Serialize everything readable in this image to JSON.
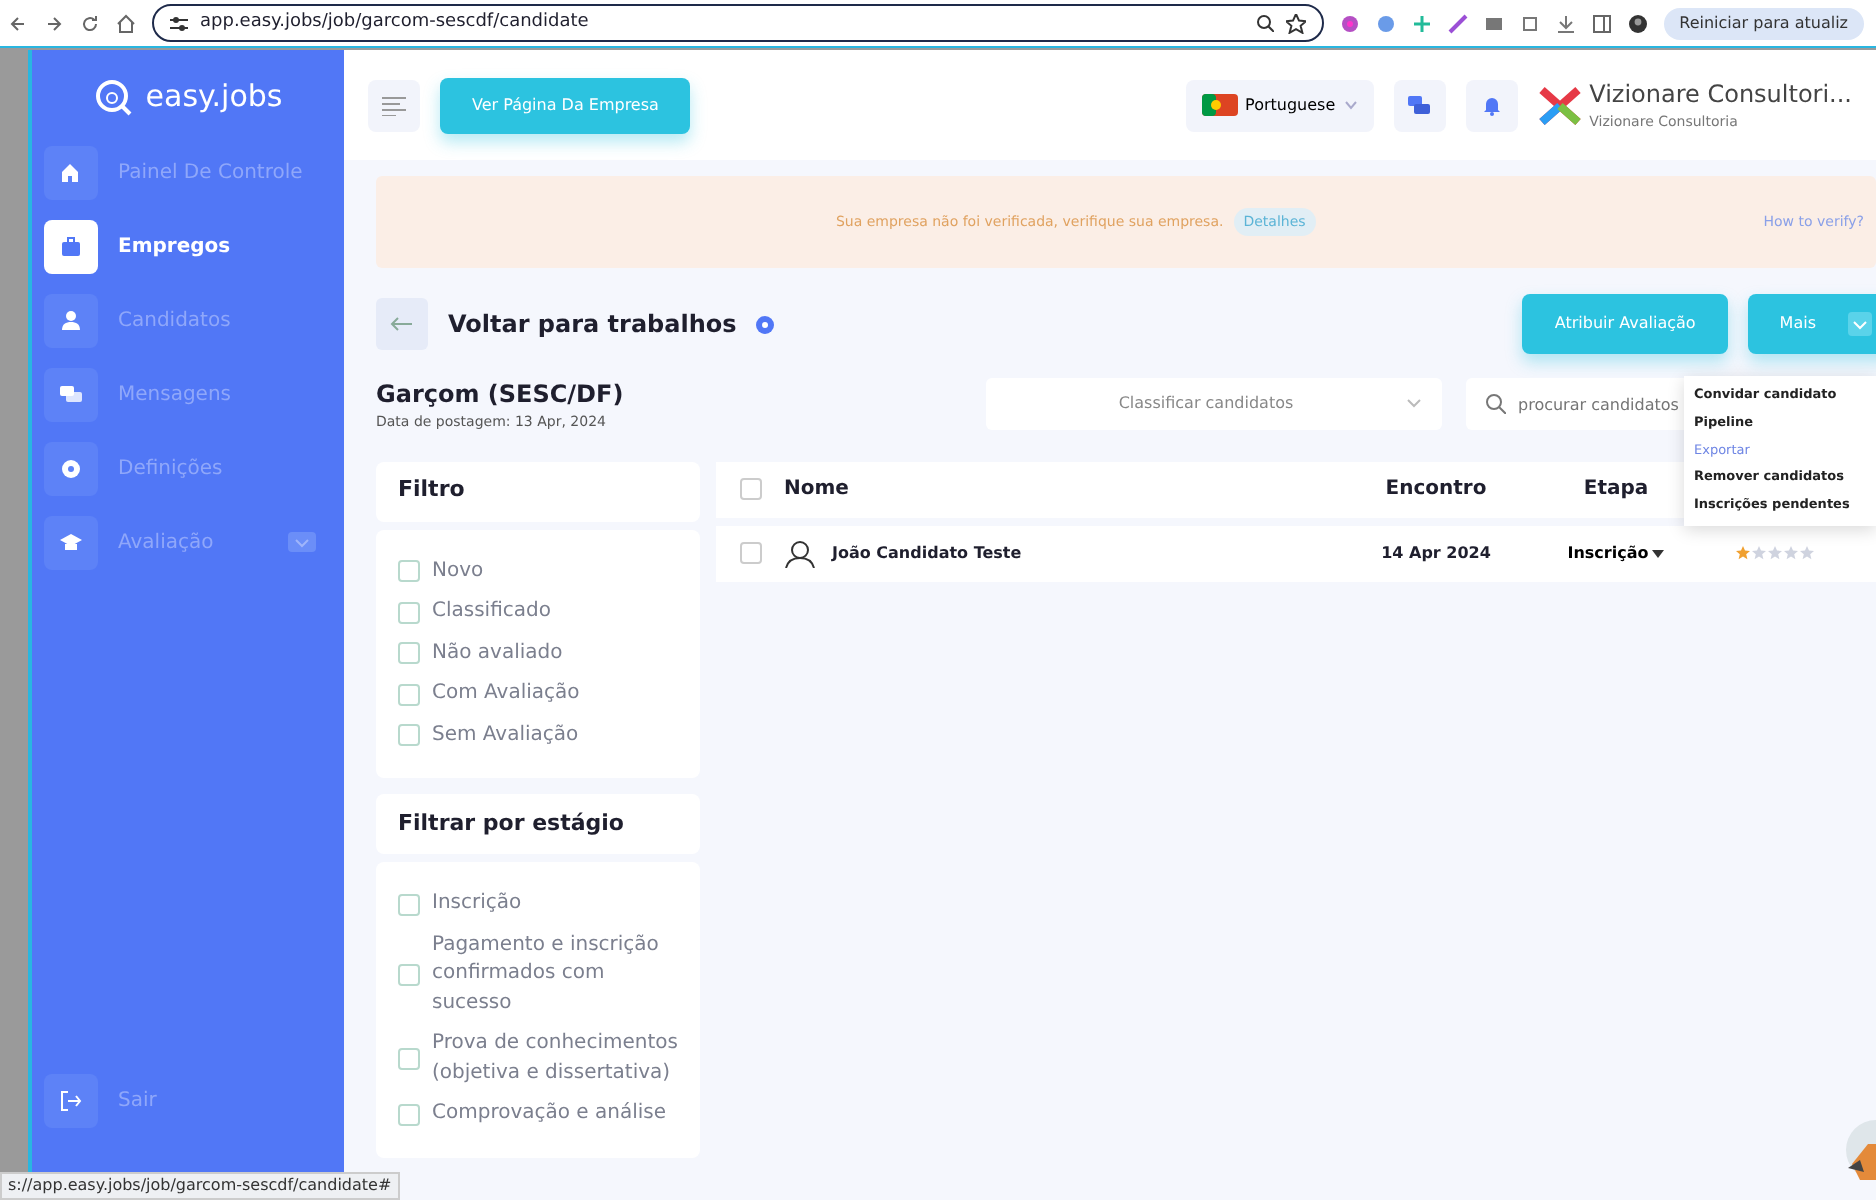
{
  "browser": {
    "url": "app.easy.jobs/job/garcom-sescdf/candidate",
    "restart_button": "Reiniciar para atualiz"
  },
  "sidebar": {
    "logo": "easy.jobs",
    "items": [
      {
        "label": "Painel De Controle",
        "selected": false,
        "expandable": false
      },
      {
        "label": "Empregos",
        "selected": true,
        "expandable": false
      },
      {
        "label": "Candidatos",
        "selected": false,
        "expandable": false
      },
      {
        "label": "Mensagens",
        "selected": false,
        "expandable": false
      },
      {
        "label": "Definições",
        "selected": false,
        "expandable": false
      },
      {
        "label": "Avaliação",
        "selected": false,
        "expandable": true
      }
    ],
    "logout": "Sair"
  },
  "topbar": {
    "company_page_button": "Ver Página Da Empresa",
    "language": "Portuguese",
    "company_name": "Vizionare Consultori...",
    "company_subtitle": "Vizionare Consultoria"
  },
  "alert": {
    "message": "Sua empresa não foi verificada, verifique sua empresa.",
    "details_button": "Detalhes",
    "help_link": "How to verify?"
  },
  "back_link": "Voltar para trabalhos",
  "actions": {
    "assign_button": "Atribuir Avaliação",
    "more_button": "Mais"
  },
  "job": {
    "title": "Garçom (SESC/DF)",
    "posted": "Data de postagem: 13 Apr, 2024"
  },
  "sort": {
    "placeholder": "Classificar candidatos"
  },
  "search": {
    "placeholder": "procurar candidatos"
  },
  "filter": {
    "title": "Filtro",
    "options": [
      {
        "label": "Novo",
        "checked": false
      },
      {
        "label": "Classificado",
        "checked": false
      },
      {
        "label": "Não avaliado",
        "checked": false
      },
      {
        "label": "Com Avaliação",
        "checked": false
      },
      {
        "label": "Sem Avaliação",
        "checked": false
      }
    ]
  },
  "stage_filter": {
    "title": "Filtrar por estágio",
    "options": [
      {
        "label": "Inscrição",
        "checked": false
      },
      {
        "label": "Pagamento e inscrição confirmados com sucesso",
        "checked": false
      },
      {
        "label": "Prova de conhecimentos (objetiva e dissertativa)",
        "checked": false
      },
      {
        "label": "Comprovação e análise",
        "checked": false
      }
    ]
  },
  "table": {
    "select_all_checked": false,
    "columns": [
      "Nome",
      "Encontro",
      "Etapa"
    ],
    "rows": [
      {
        "name": "João Candidato Teste",
        "date": "14 Apr 2024",
        "stage": "Inscrição",
        "stars": 1,
        "checked": false
      }
    ]
  },
  "menu": {
    "items": [
      {
        "label": "Convidar candidato",
        "selected": false
      },
      {
        "label": "Pipeline",
        "selected": false
      },
      {
        "label": "Exportar",
        "selected": true
      },
      {
        "label": "Remover candidatos",
        "selected": false
      },
      {
        "label": "Inscrições pendentes",
        "selected": false
      }
    ]
  },
  "status_url": "s://app.easy.jobs/job/garcom-sescdf/candidate#"
}
